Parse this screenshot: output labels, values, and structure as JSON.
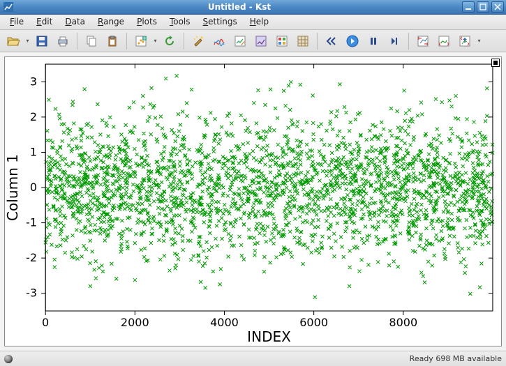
{
  "window": {
    "title": "Untitled - Kst"
  },
  "menu": {
    "file": "File",
    "edit": "Edit",
    "data": "Data",
    "range": "Range",
    "plots": "Plots",
    "tools": "Tools",
    "settings": "Settings",
    "help": "Help"
  },
  "status": {
    "text": "Ready  698 MB available"
  },
  "chart_data": {
    "type": "scatter",
    "title": "",
    "xlabel": "INDEX",
    "ylabel": "Column 1",
    "xlim": [
      0,
      10000
    ],
    "ylim": [
      -3.5,
      3.5
    ],
    "xticks": [
      0,
      2000,
      4000,
      6000,
      8000
    ],
    "yticks": [
      -3,
      -2,
      -1,
      0,
      1,
      2,
      3
    ],
    "marker": "x",
    "color": "#009900",
    "n_points": 10000,
    "distribution": "normal",
    "mean": 0,
    "stddev": 1,
    "series": [
      {
        "name": "Column 1",
        "description": "~10000 samples, index 0–9999, gaussian noise μ≈0 σ≈1, drawn as green × markers"
      }
    ]
  }
}
